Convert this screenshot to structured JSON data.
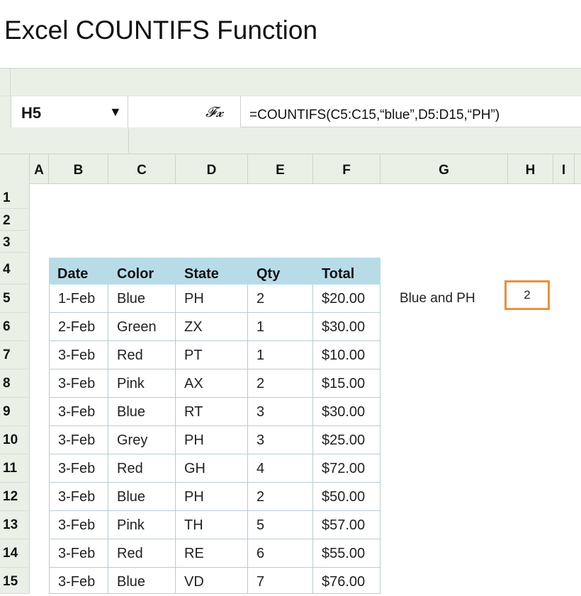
{
  "page": {
    "title": "Excel COUNTIFS Function"
  },
  "formula_bar": {
    "name_box": "H5",
    "fx_label": "𝓕𝔁",
    "formula": "=COUNTIFS(C5:C15,“blue”,D5:D15,“PH”)"
  },
  "columns": [
    "A",
    "B",
    "C",
    "D",
    "E",
    "F",
    "G",
    "H",
    "I"
  ],
  "rows": [
    "1",
    "2",
    "3",
    "4",
    "5",
    "6",
    "7",
    "8",
    "9",
    "10",
    "11",
    "12",
    "13",
    "14",
    "15"
  ],
  "table": {
    "headers": [
      "Date",
      "Color",
      "State",
      "Qty",
      "Total"
    ],
    "rows": [
      [
        "1-Feb",
        "Blue",
        "PH",
        "2",
        "$20.00"
      ],
      [
        "2-Feb",
        "Green",
        "ZX",
        "1",
        "$30.00"
      ],
      [
        "3-Feb",
        "Red",
        "PT",
        "1",
        "$10.00"
      ],
      [
        "3-Feb",
        "Pink",
        "AX",
        "2",
        "$15.00"
      ],
      [
        "3-Feb",
        "Blue",
        "RT",
        "3",
        "$30.00"
      ],
      [
        "3-Feb",
        "Grey",
        "PH",
        "3",
        "$25.00"
      ],
      [
        "3-Feb",
        "Red",
        "GH",
        "4",
        "$72.00"
      ],
      [
        "3-Feb",
        "Blue",
        "PH",
        "2",
        "$50.00"
      ],
      [
        "3-Feb",
        "Pink",
        "TH",
        "5",
        "$57.00"
      ],
      [
        "3-Feb",
        "Red",
        "RE",
        "6",
        "$55.00"
      ],
      [
        "3-Feb",
        "Blue",
        "VD",
        "7",
        "$76.00"
      ]
    ]
  },
  "result": {
    "label": "Blue and PH",
    "value": "2"
  },
  "colors": {
    "header_fill": "#b7dce8",
    "selection": "#e8913a",
    "ribbon": "#eaf0e6"
  }
}
